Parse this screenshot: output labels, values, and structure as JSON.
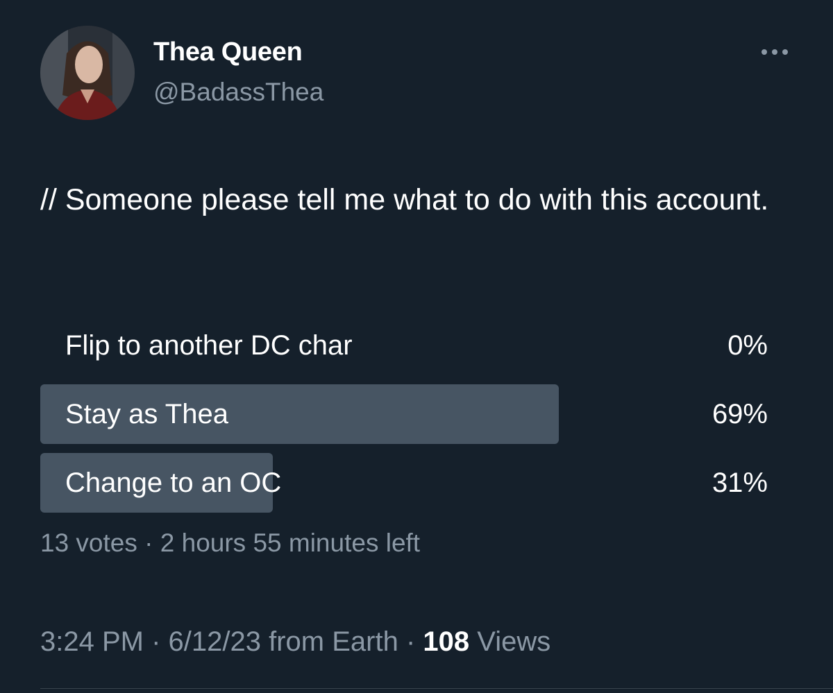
{
  "author": {
    "display_name": "Thea Queen",
    "handle": "@BadassThea",
    "avatar_icon": "profile-photo"
  },
  "tweet": {
    "text": "// Someone please tell me what to do with this account."
  },
  "poll": {
    "options": [
      {
        "label": "Flip to another DC char",
        "percent": "0%",
        "fraction": 0.0
      },
      {
        "label": "Stay as Thea",
        "percent": "69%",
        "fraction": 0.69
      },
      {
        "label": "Change to an OC",
        "percent": "31%",
        "fraction": 0.31
      }
    ],
    "votes": "13 votes",
    "separator": "·",
    "time_left": "2 hours 55 minutes left"
  },
  "footer": {
    "time": "3:24 PM",
    "date_source": "6/12/23 from Earth",
    "views_count": "108",
    "views_label": "Views",
    "separator": "·"
  },
  "colors": {
    "background": "#15202b",
    "poll_bar": "#475563",
    "secondary_text": "#8b98a5",
    "primary_text": "#ffffff"
  },
  "icons": {
    "more": "more-horizontal-icon"
  }
}
